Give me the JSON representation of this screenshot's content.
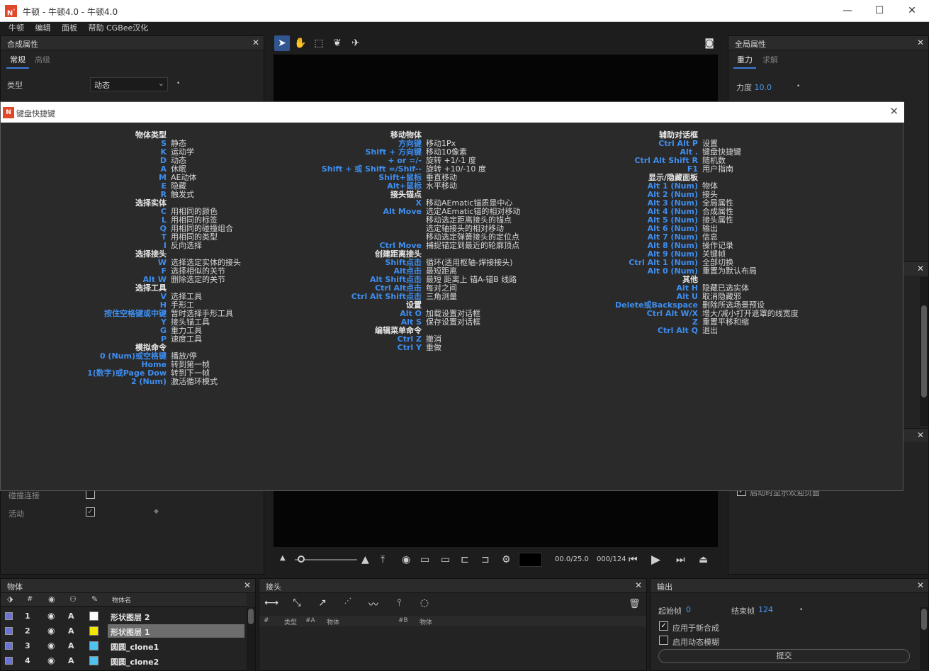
{
  "window": {
    "title": "牛顿 - 牛顿4.0 - 牛顿4.0",
    "logo_text": "N",
    "minimize": "—",
    "maximize": "☐",
    "close": "✕"
  },
  "menu": [
    "牛顿",
    "编辑",
    "面板",
    "帮助 CGBee汉化"
  ],
  "comp_panel": {
    "title": "合成属性",
    "tabs": [
      "常规",
      "高级"
    ],
    "type_label": "类型",
    "type_value": "动态",
    "bottom_rows": [
      {
        "label": "碰撞连接",
        "checked": false
      },
      {
        "label": "活动",
        "checked": true
      }
    ]
  },
  "global_panel": {
    "title": "全局属性",
    "tabs": [
      "重力",
      "求解"
    ],
    "gravity_label": "力度",
    "gravity_value": "10.0",
    "partial_text": "启动时显示欢迎页面"
  },
  "viewer": {
    "tools": [
      "select-arrow",
      "hand",
      "zoom-region",
      "brain",
      "rocket"
    ],
    "time": "00.0/25.0",
    "frame": "000/124"
  },
  "dialog": {
    "title": "键盘快捷键",
    "columns": [
      [
        {
          "key": "物体类型",
          "desc": "",
          "heading": true
        },
        {
          "key": "S",
          "desc": "静态"
        },
        {
          "key": "K",
          "desc": "运动学"
        },
        {
          "key": "D",
          "desc": "动态"
        },
        {
          "key": "A",
          "desc": "休眠"
        },
        {
          "key": "M",
          "desc": "AE动体"
        },
        {
          "key": "E",
          "desc": "隐藏"
        },
        {
          "key": "R",
          "desc": "触发式"
        },
        {
          "key": "选择实体",
          "desc": "",
          "heading": true
        },
        {
          "key": "C",
          "desc": "用相同的颜色"
        },
        {
          "key": "L",
          "desc": "用相同的标签"
        },
        {
          "key": "Q",
          "desc": "用相同的碰撞组合"
        },
        {
          "key": "T",
          "desc": "用相同的类型"
        },
        {
          "key": "I",
          "desc": "反向选择"
        },
        {
          "key": "选择接头",
          "desc": "",
          "heading": true
        },
        {
          "key": "W",
          "desc": "选择选定实体的接头"
        },
        {
          "key": "F",
          "desc": "选择相似的关节"
        },
        {
          "key": "Alt W",
          "desc": "删除选定的关节"
        },
        {
          "key": "选择工具",
          "desc": "",
          "heading": true
        },
        {
          "key": "V",
          "desc": "选择工具"
        },
        {
          "key": "H",
          "desc": "手形工"
        },
        {
          "key": "按住空格键或中键",
          "desc": "暂时选择手形工具"
        },
        {
          "key": "Y",
          "desc": "接头锚工具"
        },
        {
          "key": "G",
          "desc": "重力工具"
        },
        {
          "key": "P",
          "desc": "速度工具"
        },
        {
          "key": "模拟命令",
          "desc": "",
          "heading": true
        },
        {
          "key": "0 (Num)或空格键",
          "desc": "播放/停"
        },
        {
          "key": "Home",
          "desc": "转到第一帧"
        },
        {
          "key": "1(数字)或Page Dow",
          "desc": "转到下一帧"
        },
        {
          "key": "2 (Num)",
          "desc": "激活循环模式"
        }
      ],
      [
        {
          "key": "移动物体",
          "desc": "",
          "heading": true
        },
        {
          "key": "方向键",
          "desc": "移动1Px"
        },
        {
          "key": "Shift + 方向键",
          "desc": "移动10像素"
        },
        {
          "key": "+ or =/-",
          "desc": "旋转 +1/-1 度"
        },
        {
          "key": "Shift + 或 Shift =/Shif--",
          "desc": "旋转 +10/-10 度"
        },
        {
          "key": "Shift+鼠标",
          "desc": "垂直移动"
        },
        {
          "key": "Alt+鼠标",
          "desc": "水平移动"
        },
        {
          "key": "接头锚点",
          "desc": "",
          "heading": true
        },
        {
          "key": "X",
          "desc": "移动AEmatic锚质是中心"
        },
        {
          "key": "Alt Move",
          "desc": "选定AEmatic锚的相对移动"
        },
        {
          "key": "",
          "desc": "移动选定距离接头的锚点"
        },
        {
          "key": "",
          "desc": "选定轴接头的相对移动"
        },
        {
          "key": "",
          "desc": "移动选定弹簧接头的定位点"
        },
        {
          "key": "Ctrl Move",
          "desc": "捕捉锚定到最近的轮廓顶点"
        },
        {
          "key": "创建距离接头",
          "desc": "",
          "heading": true
        },
        {
          "key": "Shift点击",
          "desc": "循环(适用枢轴-焊接接头)"
        },
        {
          "key": "Alt点击",
          "desc": "最短距离"
        },
        {
          "key": "Alt Shift点击",
          "desc": "最短 距离上 锚A-锚B 线路"
        },
        {
          "key": "Ctrl Alt点击",
          "desc": "每对之间"
        },
        {
          "key": "Ctrl Alt Shift点击",
          "desc": "三角测量"
        },
        {
          "key": "设置",
          "desc": "",
          "heading": true
        },
        {
          "key": "Alt O",
          "desc": "加载设置对话框"
        },
        {
          "key": "Alt S",
          "desc": "保存设置对话框"
        },
        {
          "key": "编辑菜单命令",
          "desc": "",
          "heading": true
        },
        {
          "key": "Ctrl Z",
          "desc": "撤消"
        },
        {
          "key": "Ctrl Y",
          "desc": "重做"
        }
      ],
      [
        {
          "key": "辅助对话框",
          "desc": "",
          "heading": true
        },
        {
          "key": "Ctrl Alt P",
          "desc": "设置"
        },
        {
          "key": "Alt .",
          "desc": "键盘快捷键"
        },
        {
          "key": "Ctrl Alt Shift R",
          "desc": "随机数"
        },
        {
          "key": "F1",
          "desc": "用户指南"
        },
        {
          "key": "显示/隐藏面板",
          "desc": "",
          "heading": true
        },
        {
          "key": "Alt 1 (Num)",
          "desc": "物体"
        },
        {
          "key": "Alt 2 (Num)",
          "desc": "接头"
        },
        {
          "key": "Alt 3 (Num)",
          "desc": "全局属性"
        },
        {
          "key": "Alt 4 (Num)",
          "desc": "合成属性"
        },
        {
          "key": "Alt 5 (Num)",
          "desc": "接头属性"
        },
        {
          "key": "Alt 6 (Num)",
          "desc": "输出"
        },
        {
          "key": "Alt 7 (Num)",
          "desc": "信息"
        },
        {
          "key": "Alt 8 (Num)",
          "desc": "操作记录"
        },
        {
          "key": "Alt 9 (Num)",
          "desc": "关键帧"
        },
        {
          "key": "Ctrl Alt 1 (Num)",
          "desc": "全部切换"
        },
        {
          "key": "Alt 0 (Num)",
          "desc": "重置为默认布局"
        },
        {
          "key": "其他",
          "desc": "",
          "heading": true
        },
        {
          "key": "Alt H",
          "desc": "隐藏已选实体"
        },
        {
          "key": "Alt U",
          "desc": "取消隐藏邪"
        },
        {
          "key": "Delete或Backspace",
          "desc": "删除所选场景预设"
        },
        {
          "key": "Ctrl Alt W/X",
          "desc": "增大/减小打开遮罩的线宽度"
        },
        {
          "key": "Z",
          "desc": "重置平移和缩"
        },
        {
          "key": "Ctrl Alt Q",
          "desc": "退出"
        }
      ]
    ]
  },
  "objects_panel": {
    "title": "物体",
    "header": {
      "num": "#",
      "name": "物体名"
    },
    "rows": [
      {
        "num": "1",
        "a": "A",
        "swatch": "#ffffff",
        "name": "形状图层 2",
        "selected": false
      },
      {
        "num": "2",
        "a": "A",
        "swatch": "#f5e600",
        "name": "形状图层 1",
        "selected": true
      },
      {
        "num": "3",
        "a": "A",
        "swatch": "#4ec3f0",
        "name": "圆圆_clone1",
        "selected": false
      },
      {
        "num": "4",
        "a": "A",
        "swatch": "#4ec3f0",
        "name": "圆圆_clone2",
        "selected": false
      }
    ]
  },
  "joints_panel": {
    "title": "接头",
    "columns": [
      "#",
      "类型",
      "#A",
      "物体",
      "#B",
      "物体"
    ]
  },
  "output_panel": {
    "title": "输出",
    "start_label": "起始帧",
    "start_value": "0",
    "end_label": "结束帧",
    "end_value": "124",
    "apply_new_comp": "应用于新合成",
    "enable_motion_blur": "启用动态模糊",
    "submit": "提交"
  }
}
